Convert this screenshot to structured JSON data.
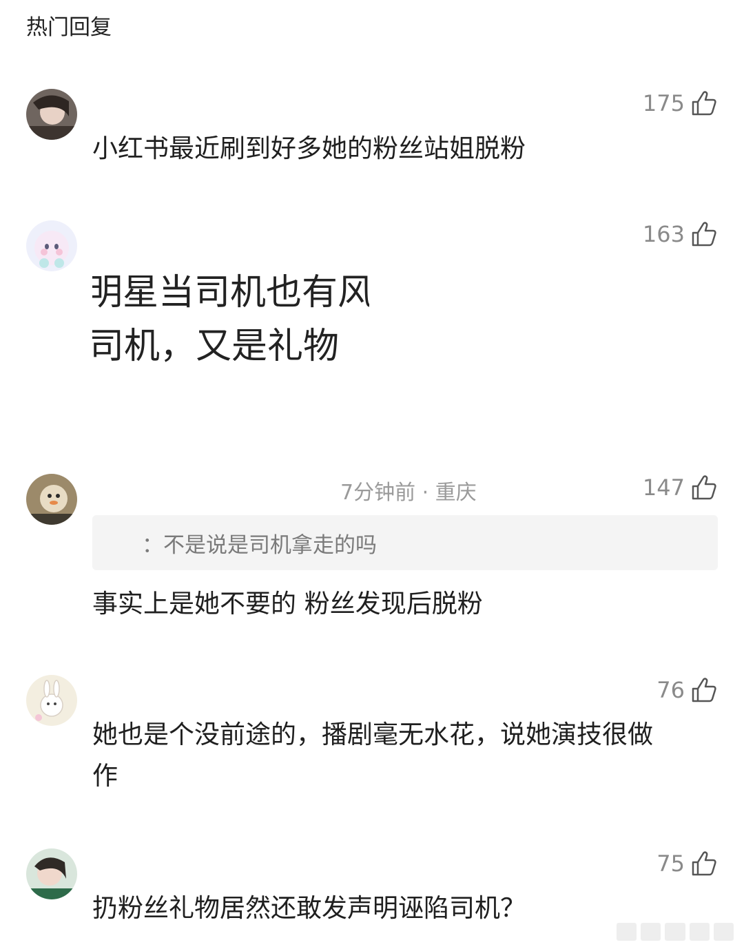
{
  "section_title": "热门回复",
  "comments": [
    {
      "likes": "175",
      "text": "小红书最近刷到好多她的粉丝站姐脱粉"
    },
    {
      "likes": "163",
      "text_line1": "明星当司机也有风",
      "text_line2": "司机，又是礼物"
    },
    {
      "likes": "147",
      "meta": "7分钟前 · 重庆",
      "quote": "：不是说是司机拿走的吗",
      "text": "事实上是她不要的 粉丝发现后脱粉"
    },
    {
      "likes": "76",
      "text_line1": "她也是个没前途的，播剧毫无水花，说她演技很做",
      "text_line2": "作"
    },
    {
      "likes": "75",
      "text": "扔粉丝礼物居然还敢发声明诬陷司机？"
    }
  ],
  "icons": {
    "like": "thumbs-up-icon"
  },
  "colors": {
    "count_gray": "#8a8a8a",
    "quote_bg": "#f4f4f4"
  }
}
